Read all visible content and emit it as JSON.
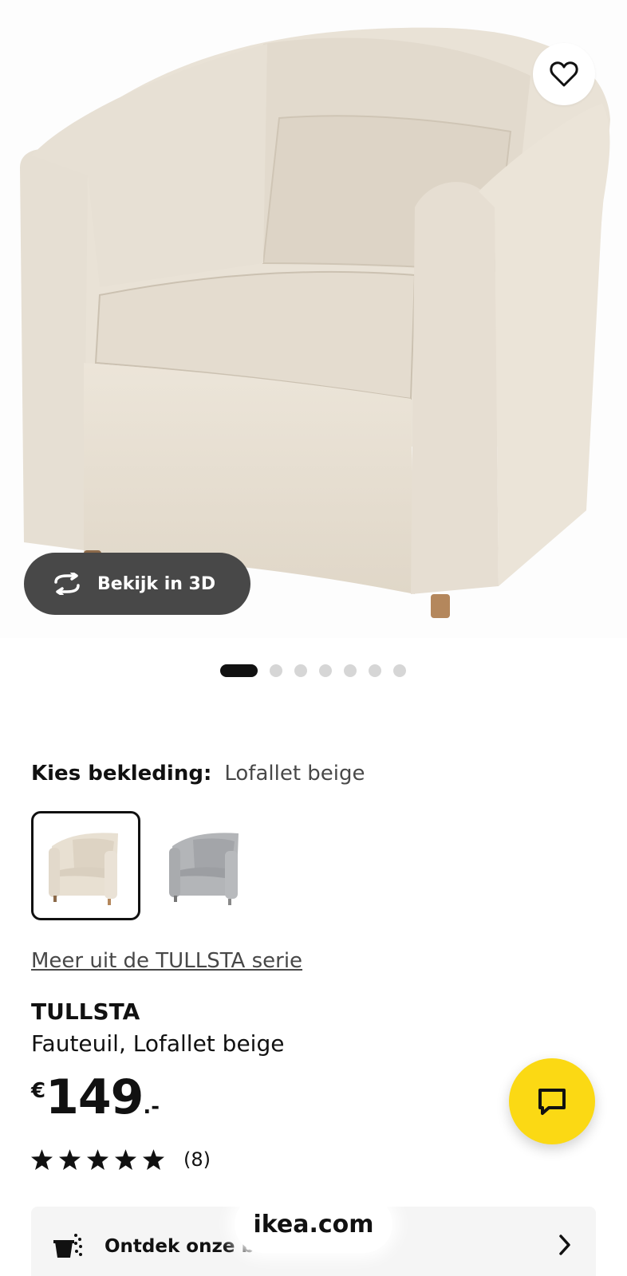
{
  "gallery": {
    "view_3d_label": "Bekijk in 3D",
    "dots_total": 7,
    "active_dot": 1
  },
  "upholstery": {
    "label": "Kies bekleding:",
    "selected": "Lofallet beige",
    "swatches": [
      {
        "name": "Lofallet beige",
        "color": "#e5ddcf"
      },
      {
        "name": "grey",
        "color": "#a9abae"
      }
    ]
  },
  "series_link": "Meer uit de TULLSTA serie",
  "product": {
    "name": "TULLSTA",
    "description": "Fauteuil, Lofallet beige",
    "price_currency": "€",
    "price_amount": "149",
    "price_decimal": ".-"
  },
  "rating": {
    "stars": 5,
    "count": "(8)"
  },
  "promo": {
    "text": "Ontdek onze be",
    "icon": "paint-bucket-icon",
    "chevron": "chevron-right-icon"
  },
  "browser": {
    "url": "ikea.com"
  },
  "colors": {
    "chat_fab": "#fbd914",
    "dark_button": "#484848"
  }
}
